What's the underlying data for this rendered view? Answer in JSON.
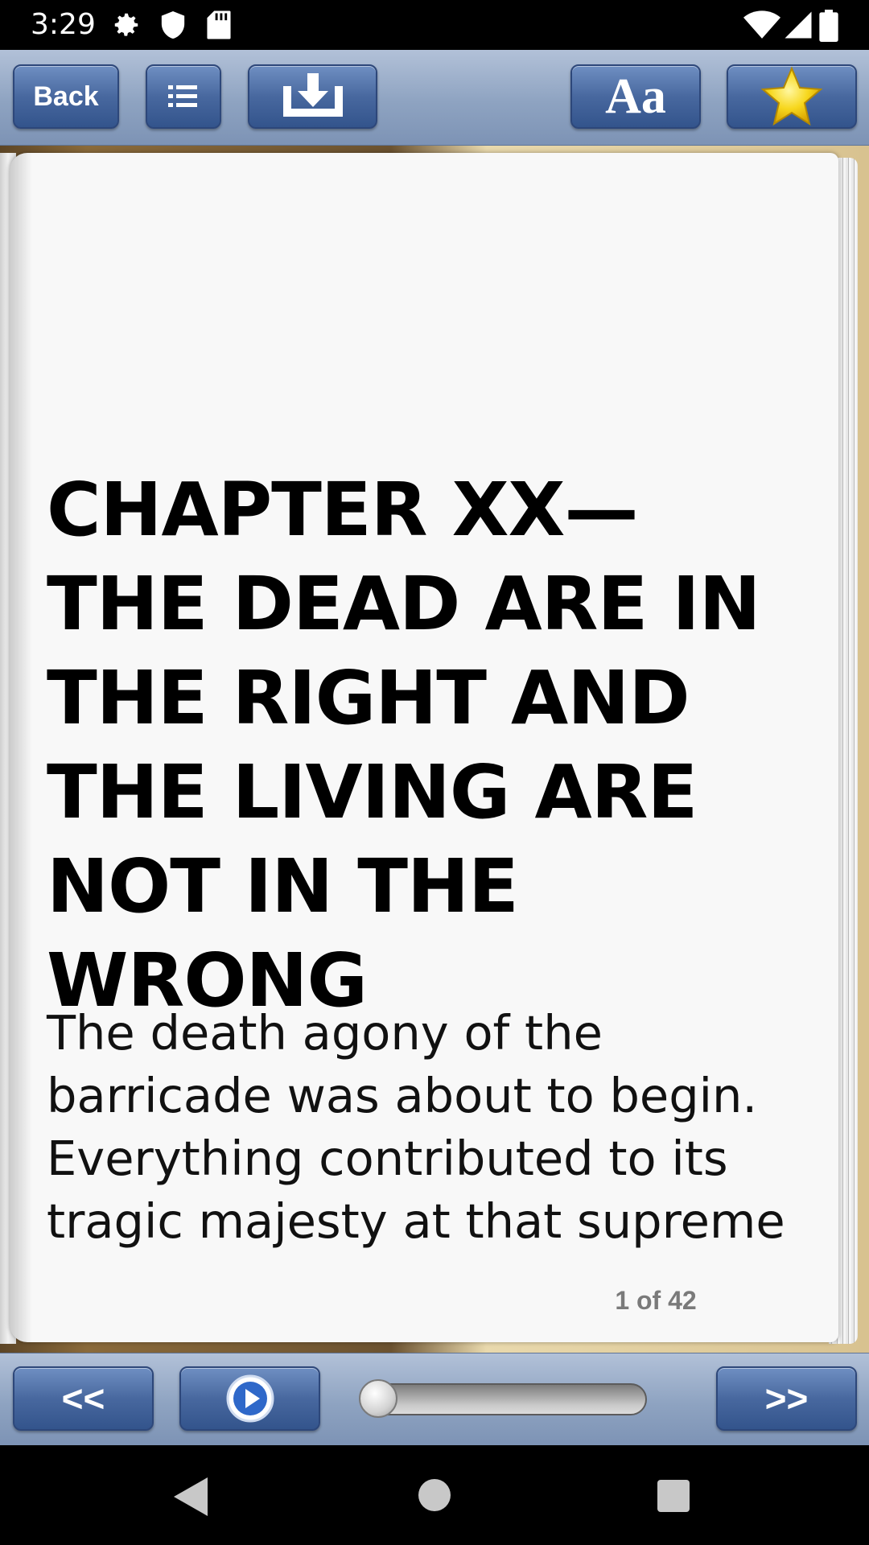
{
  "status_bar": {
    "time": "3:29",
    "left_icons": [
      "gear-icon",
      "shield-icon",
      "sd-card-icon"
    ],
    "right_icons": [
      "wifi-icon",
      "signal-icon",
      "battery-icon"
    ]
  },
  "toolbar": {
    "back_label": "Back",
    "font_label": "Aa",
    "icons": [
      "list-icon",
      "download-icon",
      "star-icon"
    ]
  },
  "book": {
    "chapter_title": "CHAPTER XX—THE DEAD ARE IN THE RIGHT AND THE LIVING ARE NOT IN THE WRONG",
    "body_text": "The death agony of the barricade was about to begin. Everything contributed to its tragic majesty at that supreme",
    "page_indicator": "1 of 42"
  },
  "bottom_bar": {
    "prev_label": "<<",
    "next_label": ">>",
    "progress_fraction": 0.0,
    "icons": [
      "play-icon"
    ]
  },
  "colors": {
    "toolbar_button": "#48689f",
    "page_background": "#f8f8f8",
    "page_number": "#7a7a7a",
    "star": "#f7d71d"
  }
}
